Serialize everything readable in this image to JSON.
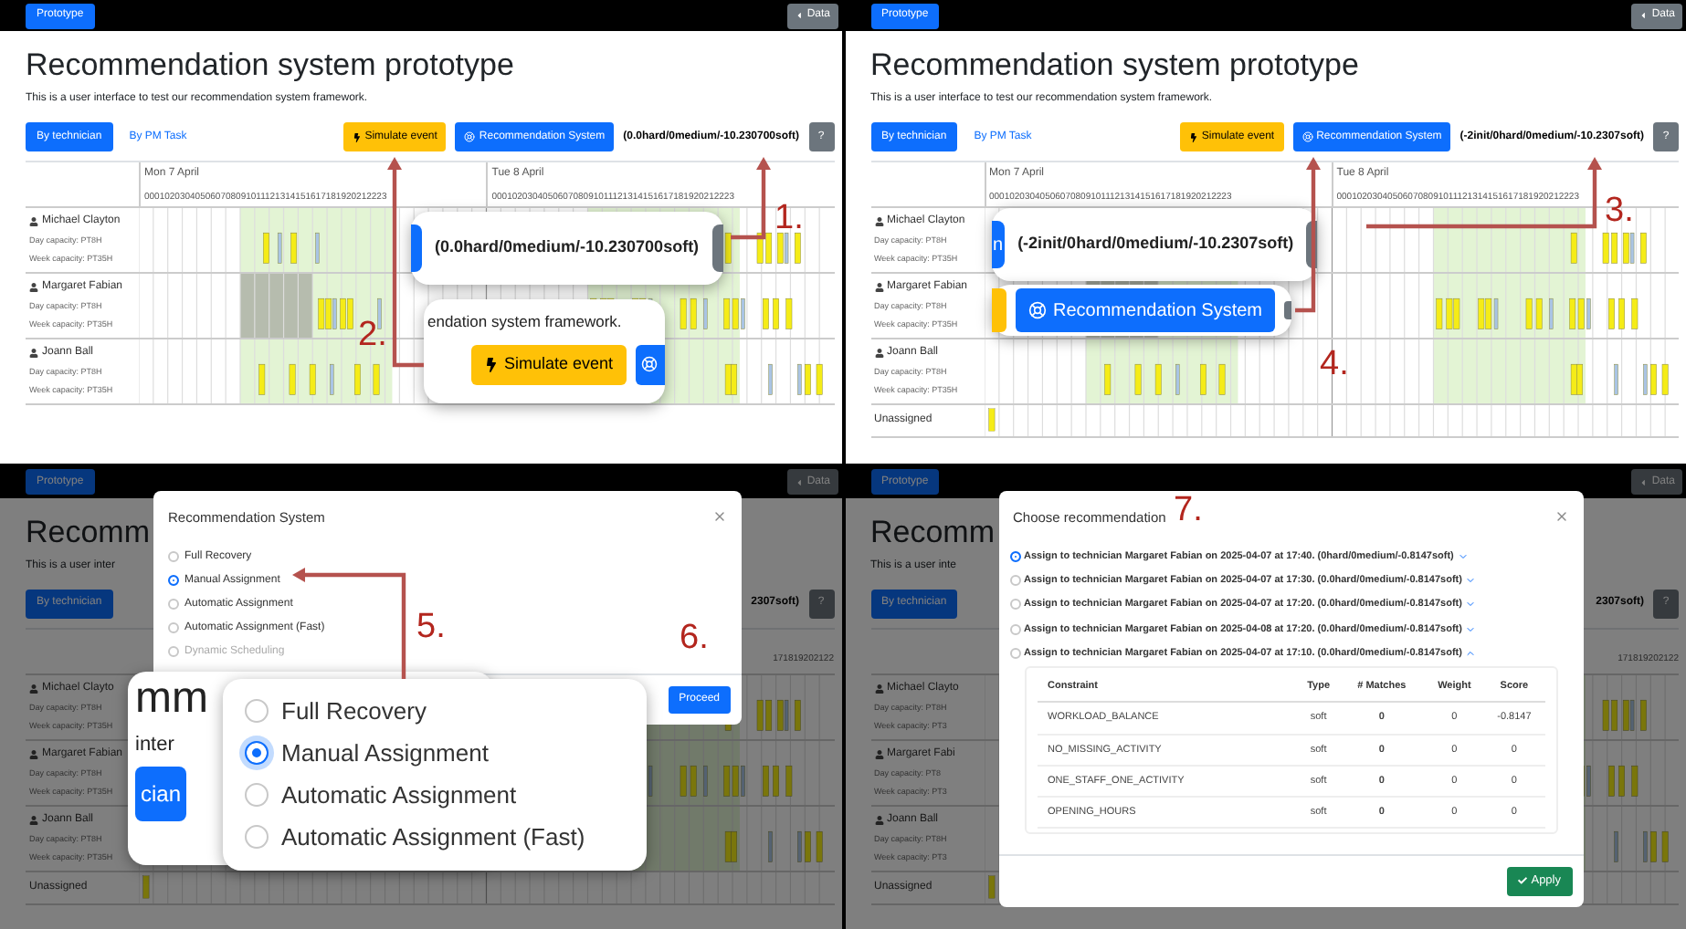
{
  "panels": [
    {
      "app": {
        "navbar": {
          "brand": "Prototype",
          "data": "Data"
        },
        "title": "Recommendation system prototype",
        "subtitle": "This is a user interface to test our recommendation system framework.",
        "toolbar": [
          {
            "kind": "view",
            "label": "By technician",
            "selected": true
          },
          {
            "kind": "view",
            "label": "By PM Task",
            "selected": false
          },
          {
            "kind": "simulate",
            "label": "Simulate event"
          },
          {
            "kind": "recommend",
            "label": "Recommendation System"
          },
          {
            "kind": "score",
            "label": "(0.0hard/0medium/-10.230700soft)"
          },
          {
            "kind": "help",
            "label": "?"
          }
        ],
        "gantt": {
          "days": [
            {
              "label": "Mon 7 April",
              "hours": "000102030405060708091011121314151617181920212223"
            },
            {
              "label": "Tue 8 April",
              "hours": "000102030405060708091011121314151617181920212223"
            }
          ],
          "rows": [
            {
              "name": "Michael Clayton",
              "day_capacity": "Day capacity: PT8H",
              "week_capacity": "Week capacity: PT35H"
            },
            {
              "name": "Margaret Fabian",
              "day_capacity": "Day capacity: PT8H",
              "week_capacity": "Week capacity: PT35H"
            },
            {
              "name": "Joann Ball",
              "day_capacity": "Day capacity: PT8H",
              "week_capacity": "Week capacity: PT35H"
            }
          ]
        }
      },
      "callouts": [
        {
          "kind": "score_zoom",
          "text": "(0.0hard/0medium/-10.230700soft)"
        },
        {
          "kind": "simulate_zoom",
          "text": "endation system framework.",
          "button": "Simulate event"
        }
      ],
      "annotations": [
        {
          "label": "1."
        },
        {
          "label": "2."
        }
      ]
    },
    {
      "app": {
        "navbar": {
          "brand": "Prototype",
          "data": "Data"
        },
        "title": "Recommendation system prototype",
        "subtitle": "This is a user interface to test our recommendation system framework.",
        "toolbar": [
          {
            "kind": "view",
            "label": "By technician",
            "selected": true
          },
          {
            "kind": "view",
            "label": "By PM Task",
            "selected": false
          },
          {
            "kind": "simulate",
            "label": "Simulate event"
          },
          {
            "kind": "recommend",
            "label": "Recommendation System"
          },
          {
            "kind": "score",
            "label": "(-2init/0hard/0medium/-10.2307soft)"
          },
          {
            "kind": "help",
            "label": "?"
          }
        ],
        "gantt": {
          "days": [
            {
              "label": "Mon 7 April",
              "hours": "000102030405060708091011121314151617181920212223"
            },
            {
              "label": "Tue 8 April",
              "hours": "000102030405060708091011121314151617181920212223"
            }
          ],
          "rows": [
            {
              "name": "Michael Clayton",
              "day_capacity": "Day capacity: PT8H",
              "week_capacity": "Week capacity: PT35H"
            },
            {
              "name": "Margaret Fabian",
              "day_capacity": "Day capacity: PT8H",
              "week_capacity": "Week capacity: PT35H"
            },
            {
              "name": "Joann Ball",
              "day_capacity": "Day capacity: PT8H",
              "week_capacity": "Week capacity: PT35H"
            }
          ],
          "unassigned": "Unassigned"
        }
      },
      "callouts": [
        {
          "kind": "score_zoom",
          "left_fragment": "n",
          "text": "(-2init/0hard/0medium/-10.2307soft)"
        },
        {
          "kind": "recommend_zoom",
          "button": "Recommendation System"
        }
      ],
      "annotations": [
        {
          "label": "3."
        },
        {
          "label": "4."
        }
      ]
    },
    {
      "app": {
        "navbar": {
          "brand": "Prototype",
          "data": "Data"
        },
        "title": "Recomm",
        "subtitle": "This is a user inter",
        "toolbar": [
          {
            "kind": "view",
            "label": "By technician",
            "selected": true
          },
          {
            "kind": "score",
            "label": "2307soft)"
          },
          {
            "kind": "help",
            "label": "?"
          }
        ],
        "gantt": {
          "hours_tail": "171819202122",
          "rows": [
            {
              "name": "Michael Clayto",
              "day_capacity": "Day capacity: PT8H",
              "week_capacity": "Week capacity: PT35H"
            },
            {
              "name": "Margaret Fabian",
              "day_capacity": "Day capacity: PT8H",
              "week_capacity": "Week capacity: PT35H"
            },
            {
              "name": "Joann Ball",
              "day_capacity": "Day capacity: PT8H",
              "week_capacity": "Week capacity: PT35H"
            }
          ],
          "unassigned": "Unassigned"
        }
      },
      "modal": {
        "kind": "mode_picker",
        "title": "Recommendation System",
        "options": [
          {
            "label": "Full Recovery",
            "selected": false,
            "disabled": false
          },
          {
            "label": "Manual Assignment",
            "selected": true,
            "disabled": false
          },
          {
            "label": "Automatic Assignment",
            "selected": false,
            "disabled": false
          },
          {
            "label": "Automatic Assignment (Fast)",
            "selected": false,
            "disabled": false
          },
          {
            "label": "Dynamic Scheduling",
            "selected": false,
            "disabled": true
          }
        ],
        "action": "Proceed"
      },
      "callouts": [
        {
          "kind": "page_zoom",
          "title_fragment": "mm",
          "subtitle_fragment": "inter",
          "button_fragment": "cian"
        },
        {
          "kind": "radio_zoom",
          "options": [
            {
              "label": "Full Recovery",
              "selected": false
            },
            {
              "label": "Manual Assignment",
              "selected": true
            },
            {
              "label": "Automatic Assignment",
              "selected": false
            },
            {
              "label": "Automatic Assignment (Fast)",
              "selected": false
            }
          ]
        }
      ],
      "annotations": [
        {
          "label": "5."
        },
        {
          "label": "6."
        }
      ]
    },
    {
      "app": {
        "navbar": {
          "brand": "Prototype",
          "data": "Data"
        },
        "title": "Recomm",
        "subtitle": "This is a user inte",
        "toolbar": [
          {
            "kind": "view",
            "label": "By technician",
            "selected": true
          },
          {
            "kind": "score",
            "label": "2307soft)"
          },
          {
            "kind": "help",
            "label": "?"
          }
        ],
        "gantt": {
          "hours_tail": "171819202122",
          "rows": [
            {
              "name": "Michael Clayto",
              "day_capacity": "Day capacity: PT8H",
              "week_capacity": "Week capacity: PT3"
            },
            {
              "name": "Margaret Fabi",
              "day_capacity": "Day capacity: PT8",
              "week_capacity": "Week capacity: PT3"
            },
            {
              "name": "Joann Ball",
              "day_capacity": "Day capacity: PT8H",
              "week_capacity": "Week capacity: PT3"
            }
          ],
          "unassigned": "Unassigned"
        }
      },
      "modal": {
        "kind": "recommendation_picker",
        "title": "Choose recommendation",
        "options": [
          {
            "label": "Assign to technician Margaret Fabian on 2025-04-07 at 17:40. (0hard/0medium/-0.8147soft)",
            "selected": true,
            "expanded": false
          },
          {
            "label": "Assign to technician Margaret Fabian on 2025-04-07 at 17:30. (0.0hard/0medium/-0.8147soft)",
            "selected": false,
            "expanded": false
          },
          {
            "label": "Assign to technician Margaret Fabian on 2025-04-07 at 17:20. (0.0hard/0medium/-0.8147soft)",
            "selected": false,
            "expanded": false
          },
          {
            "label": "Assign to technician Margaret Fabian on 2025-04-08 at 17:20. (0.0hard/0medium/-0.8147soft)",
            "selected": false,
            "expanded": false
          },
          {
            "label": "Assign to technician Margaret Fabian on 2025-04-07 at 17:10. (0.0hard/0medium/-0.8147soft)",
            "selected": false,
            "expanded": true,
            "details": {
              "columns": [
                "Constraint",
                "Type",
                "# Matches",
                "Weight",
                "Score"
              ],
              "rows": [
                [
                  "WORKLOAD_BALANCE",
                  "soft",
                  "0",
                  "0",
                  "-0.8147"
                ],
                [
                  "NO_MISSING_ACTIVITY",
                  "soft",
                  "0",
                  "0",
                  "0"
                ],
                [
                  "ONE_STAFF_ONE_ACTIVITY",
                  "soft",
                  "0",
                  "0",
                  "0"
                ],
                [
                  "OPENING_HOURS",
                  "soft",
                  "0",
                  "0",
                  "0"
                ]
              ]
            }
          }
        ],
        "action": "Apply"
      },
      "annotations": [
        {
          "label": "7."
        }
      ]
    }
  ]
}
